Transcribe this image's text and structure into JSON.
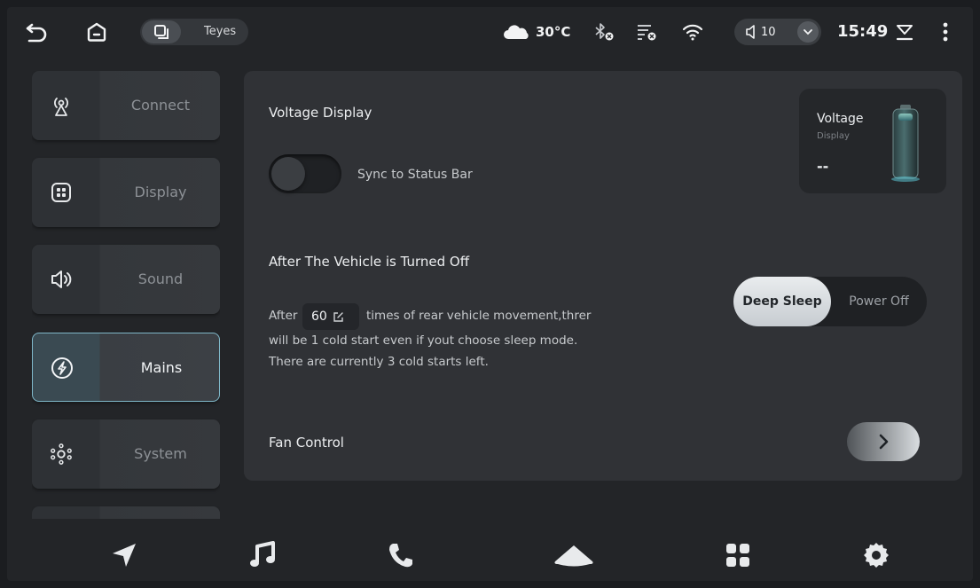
{
  "status_bar": {
    "app_pill_label": "Teyes",
    "weather_temp": "30°C",
    "volume_level": "10",
    "time": "15:49",
    "icons": [
      "back-icon",
      "home-icon",
      "multiwindow-icon",
      "cloud-icon",
      "bluetooth-off-icon",
      "signal-off-icon",
      "wifi-icon",
      "speaker-icon",
      "chevron-down-icon",
      "download-icon",
      "more-icon"
    ]
  },
  "sidebar": {
    "items": [
      {
        "label": "Connect",
        "icon": "antenna-icon",
        "active": false
      },
      {
        "label": "Display",
        "icon": "grid-icon",
        "active": false
      },
      {
        "label": "Sound",
        "icon": "speaker-icon",
        "active": false
      },
      {
        "label": "Mains",
        "icon": "lightning-icon",
        "active": true
      },
      {
        "label": "System",
        "icon": "system-icon",
        "active": false
      }
    ]
  },
  "main": {
    "voltage_display": {
      "title": "Voltage Display",
      "toggle_label": "Sync to Status Bar",
      "toggle_on": false,
      "card": {
        "title": "Voltage",
        "subtitle": "Display",
        "value": "--"
      }
    },
    "after_off": {
      "title": "After The Vehicle is Turned Off",
      "line1_prefix": "After",
      "count": "60",
      "line1_suffix": "times of rear vehicle movement,threr",
      "line2": "will be 1 cold start even if yout choose sleep mode.",
      "line3": "There are currently 3 cold starts left.",
      "options": [
        "Deep Sleep",
        "Power Off"
      ],
      "selected": "Deep Sleep"
    },
    "fan_control": {
      "title": "Fan Control"
    }
  },
  "dock": {
    "items": [
      "navigation-icon",
      "music-icon",
      "phone-icon",
      "collapse-icon",
      "apps-icon",
      "settings-icon"
    ]
  }
}
